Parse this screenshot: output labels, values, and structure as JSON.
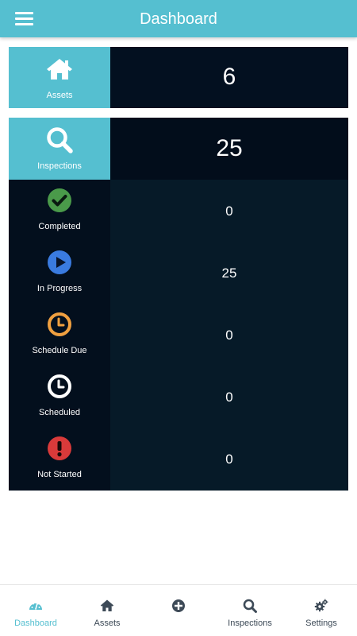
{
  "header": {
    "title": "Dashboard",
    "menu_icon": "hamburger-menu-icon"
  },
  "assets_card": {
    "label": "Assets",
    "icon": "house-icon",
    "value": "6"
  },
  "inspections_card": {
    "label": "Inspections",
    "icon": "magnifier-icon",
    "value": "25",
    "statuses": [
      {
        "label": "Completed",
        "icon": "check-circle-icon",
        "color": "#4a9a4a",
        "value": "0"
      },
      {
        "label": "In Progress",
        "icon": "play-circle-icon",
        "color": "#3a7be0",
        "value": "25"
      },
      {
        "label": "Schedule Due",
        "icon": "clock-icon",
        "color": "#f0a040",
        "value": "0"
      },
      {
        "label": "Scheduled",
        "icon": "clock-icon",
        "color": "#ffffff",
        "value": "0"
      },
      {
        "label": "Not Started",
        "icon": "exclamation-circle-icon",
        "color": "#d93a3a",
        "value": "0"
      }
    ]
  },
  "bottom_nav": {
    "items": [
      {
        "label": "Dashboard",
        "icon": "speedometer-icon",
        "active": true
      },
      {
        "label": "Assets",
        "icon": "house-icon",
        "active": false
      },
      {
        "label": "",
        "icon": "plus-circle-icon",
        "active": false
      },
      {
        "label": "Inspections",
        "icon": "magnifier-icon",
        "active": false
      },
      {
        "label": "Settings",
        "icon": "gears-icon",
        "active": false
      }
    ]
  },
  "colors": {
    "accent": "#55bfd0",
    "card_dark": "#061a28",
    "nav_text": "#3d4a57"
  }
}
